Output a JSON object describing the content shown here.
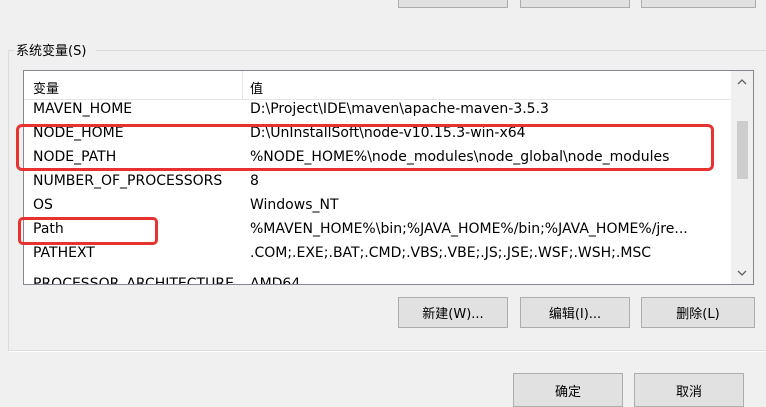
{
  "system_vars": {
    "group_label": "系统变量(S)",
    "columns": {
      "name": "变量",
      "value": "值"
    },
    "rows": [
      {
        "name": "MAVEN_HOME",
        "value": "D:\\Project\\IDE\\maven\\apache-maven-3.5.3"
      },
      {
        "name": "NODE_HOME",
        "value": "D:\\UnInstallSoft\\node-v10.15.3-win-x64"
      },
      {
        "name": "NODE_PATH",
        "value": "%NODE_HOME%\\node_modules\\node_global\\node_modules"
      },
      {
        "name": "NUMBER_OF_PROCESSORS",
        "value": "8"
      },
      {
        "name": "OS",
        "value": "Windows_NT"
      },
      {
        "name": "Path",
        "value": "%MAVEN_HOME%\\bin;%JAVA_HOME%/bin;%JAVA_HOME%/jre..."
      },
      {
        "name": "PATHEXT",
        "value": ".COM;.EXE;.BAT;.CMD;.VBS;.VBE;.JS;.JSE;.WSF;.WSH;.MSC"
      },
      {
        "name": "PROCESSOR_ARCHITECTURE",
        "value": "AMD64"
      }
    ],
    "buttons": {
      "new": "新建(W)...",
      "edit": "编辑(I)...",
      "delete": "删除(L)"
    }
  },
  "dialog_buttons": {
    "ok": "确定",
    "cancel": "取消"
  },
  "highlight_color": "#e8322f",
  "icons": {
    "scroll_up": "chevron-up-icon",
    "scroll_down": "chevron-down-icon"
  }
}
